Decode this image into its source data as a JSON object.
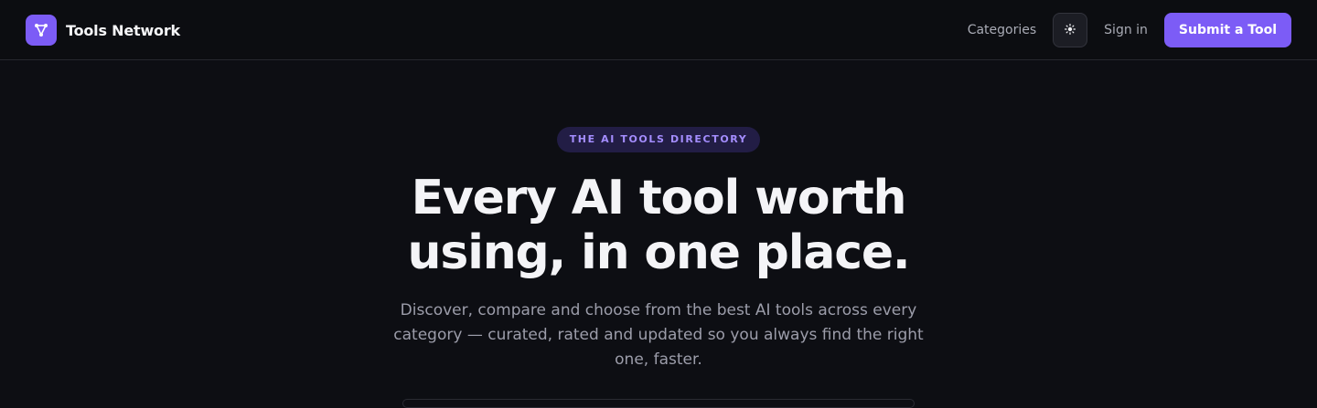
{
  "nav": {
    "brand_name": "Tools Network",
    "categories_label": "Categories",
    "theme_toggle_glyph": "☀",
    "sign_in_label": "Sign in",
    "submit_label": "Submit a Tool"
  },
  "hero": {
    "eyebrow": "THE AI TOOLS DIRECTORY",
    "headline": "Every AI tool worth using, in one place.",
    "subhead": "Discover, compare and choose from the best AI tools across every category — curated, rated and updated so you always find the right one, faster."
  },
  "colors": {
    "accent": "#7c5cf6",
    "background": "#0d0e13"
  },
  "icons": {
    "logo": "network-nodes-icon",
    "theme_toggle": "sun-icon"
  }
}
